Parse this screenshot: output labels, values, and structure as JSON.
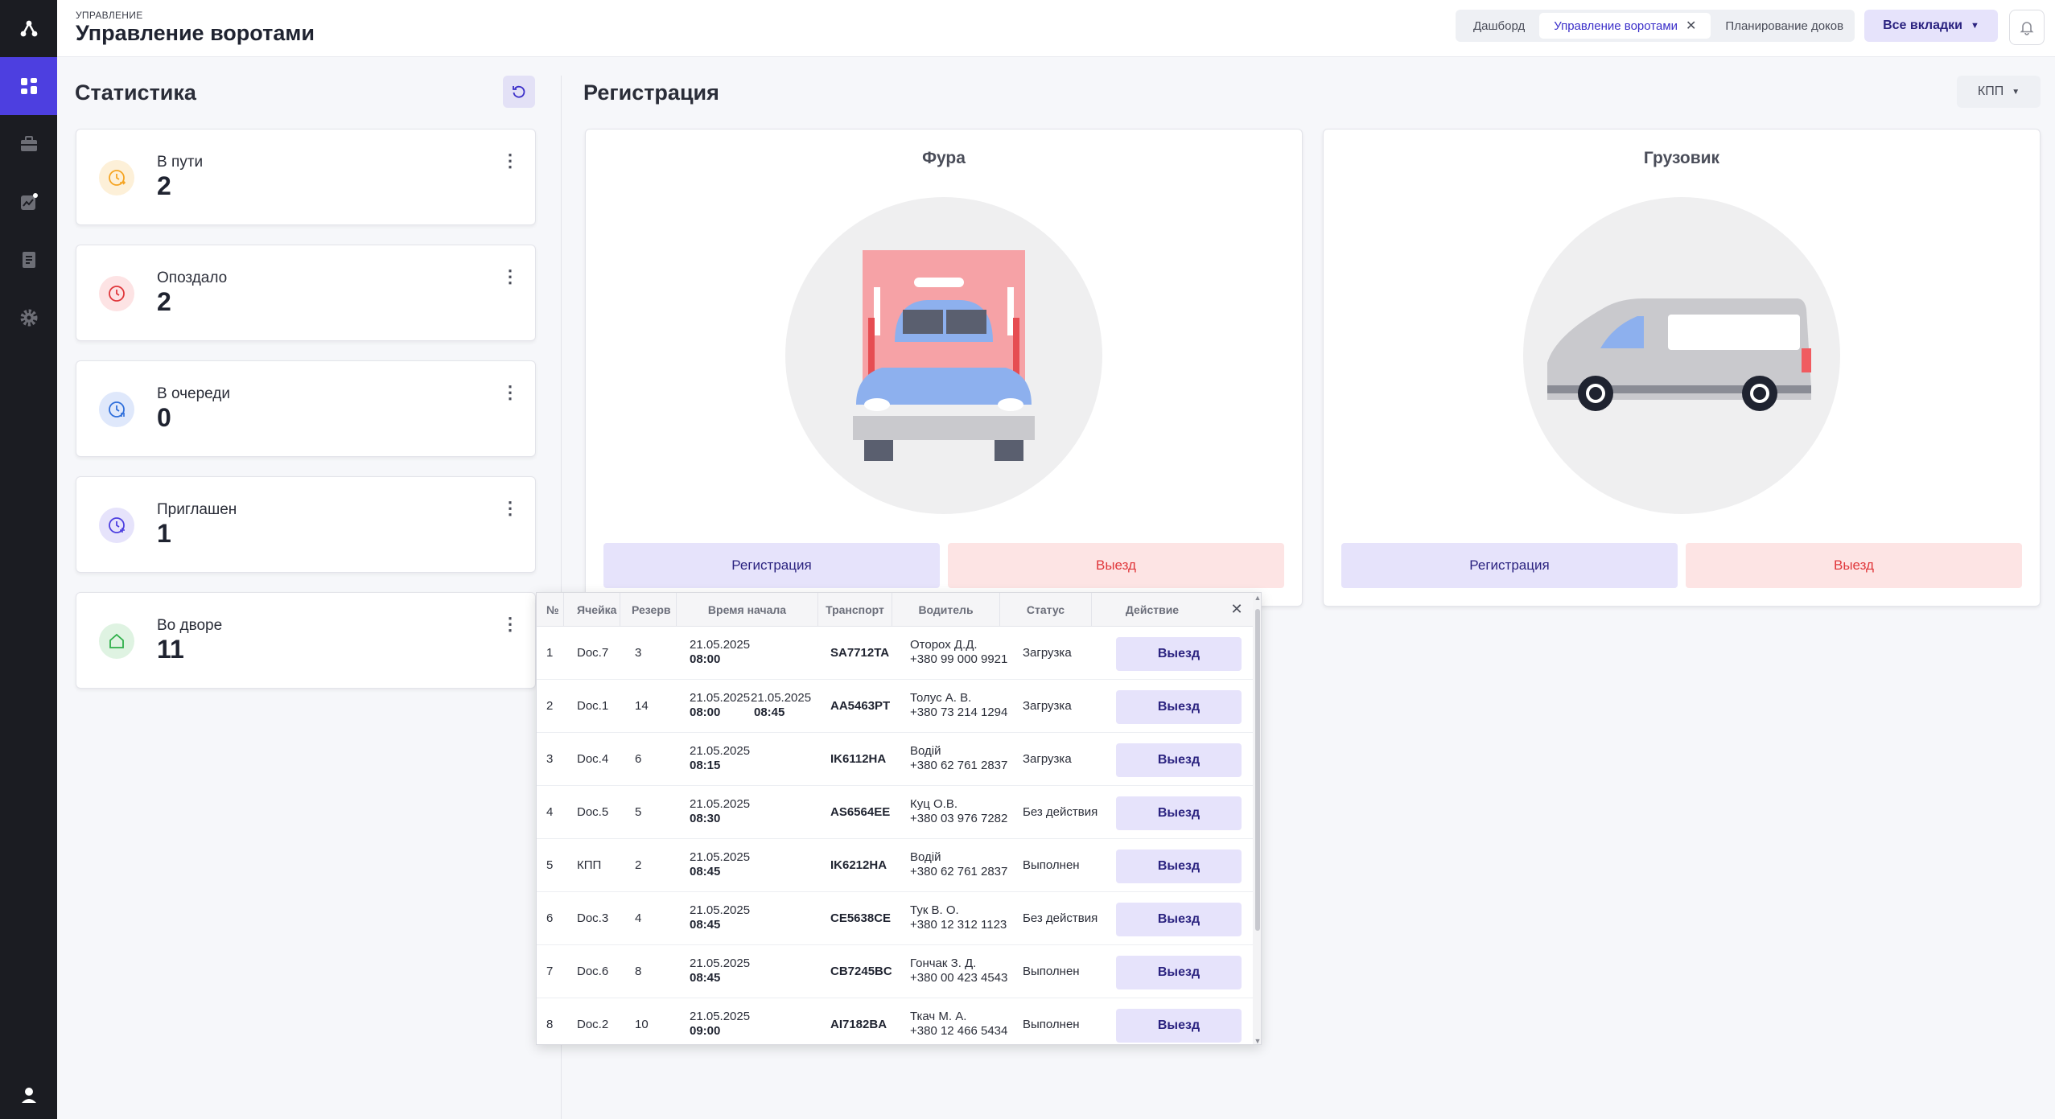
{
  "header": {
    "kicker": "УПРАВЛЕНИЕ",
    "title": "Управление воротами",
    "tabs": [
      {
        "label": "Дашборд"
      },
      {
        "label": "Управление воротами"
      },
      {
        "label": "Планирование доков"
      }
    ],
    "all_tabs_label": "Все вкладки"
  },
  "stats": {
    "title": "Статистика",
    "cards": [
      {
        "label": "В пути",
        "value": "2",
        "color": "#f5a524"
      },
      {
        "label": "Опоздало",
        "value": "2",
        "color": "#e0373b"
      },
      {
        "label": "В очереди",
        "value": "0",
        "color": "#2f6fdb"
      },
      {
        "label": "Приглашен",
        "value": "1",
        "color": "#4d3fe0"
      },
      {
        "label": "Во дворе",
        "value": "11",
        "color": "#2fb04a"
      }
    ]
  },
  "registration": {
    "title": "Регистрация",
    "filter_label": "КПП",
    "vehicles": [
      {
        "title": "Фура",
        "register_label": "Регистрация",
        "exit_label": "Выезд"
      },
      {
        "title": "Грузовик",
        "register_label": "Регистрация",
        "exit_label": "Выезд"
      }
    ]
  },
  "table": {
    "columns": [
      "№",
      "Ячейка",
      "Резерв",
      "Время начала",
      "Транспорт",
      "Водитель",
      "Статус",
      "Действие"
    ],
    "rows": [
      {
        "n": "1",
        "cell": "Doc.7",
        "reserve": "3",
        "date": "21.05.2025",
        "time": "08:00",
        "end_date": "",
        "end_time": "",
        "plate": "SA7712TA",
        "driver": "Оторох Д.Д.",
        "phone": "+380 99 000 9921",
        "status": "Загрузка",
        "action": "Выезд"
      },
      {
        "n": "2",
        "cell": "Doc.1",
        "reserve": "14",
        "date": "21.05.2025",
        "time": "08:00",
        "end_date": "21.05.2025",
        "end_time": "08:45",
        "plate": "AA5463PT",
        "driver": "Толус А. В.",
        "phone": "+380 73 214 1294",
        "status": "Загрузка",
        "action": "Выезд"
      },
      {
        "n": "3",
        "cell": "Doc.4",
        "reserve": "6",
        "date": "21.05.2025",
        "time": "08:15",
        "end_date": "",
        "end_time": "",
        "plate": "IK6112HA",
        "driver": "Водій",
        "phone": "+380 62 761 2837",
        "status": "Загрузка",
        "action": "Выезд"
      },
      {
        "n": "4",
        "cell": "Doc.5",
        "reserve": "5",
        "date": "21.05.2025",
        "time": "08:30",
        "end_date": "",
        "end_time": "",
        "plate": "AS6564EE",
        "driver": "Куц О.В.",
        "phone": "+380 03 976 7282",
        "status": "Без действия",
        "action": "Выезд"
      },
      {
        "n": "5",
        "cell": "КПП",
        "reserve": "2",
        "date": "21.05.2025",
        "time": "08:45",
        "end_date": "",
        "end_time": "",
        "plate": "IK6212HA",
        "driver": "Водій",
        "phone": "+380 62 761 2837",
        "status": "Выполнен",
        "action": "Выезд"
      },
      {
        "n": "6",
        "cell": "Doc.3",
        "reserve": "4",
        "date": "21.05.2025",
        "time": "08:45",
        "end_date": "",
        "end_time": "",
        "plate": "CE5638CE",
        "driver": "Тук В. О.",
        "phone": "+380 12 312 1123",
        "status": "Без действия",
        "action": "Выезд"
      },
      {
        "n": "7",
        "cell": "Doc.6",
        "reserve": "8",
        "date": "21.05.2025",
        "time": "08:45",
        "end_date": "",
        "end_time": "",
        "plate": "CB7245BC",
        "driver": "Гончак З. Д.",
        "phone": "+380 00 423 4543",
        "status": "Выполнен",
        "action": "Выезд"
      },
      {
        "n": "8",
        "cell": "Doc.2",
        "reserve": "10",
        "date": "21.05.2025",
        "time": "09:00",
        "end_date": "",
        "end_time": "",
        "plate": "AI7182BA",
        "driver": "Ткач М. А.",
        "phone": "+380 12 466 5434",
        "status": "Выполнен",
        "action": "Выезд"
      }
    ]
  },
  "colors": {
    "accent": "#4d3fe0",
    "sidebar": "#1b1c22",
    "exit": "#e0373b"
  }
}
